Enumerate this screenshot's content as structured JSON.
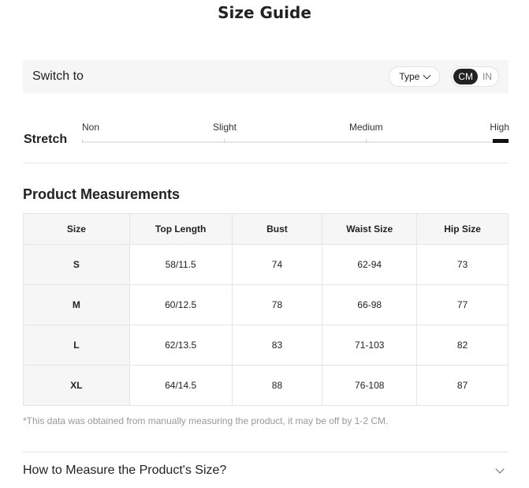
{
  "title": "Size Guide",
  "switch_bar": {
    "label": "Switch to",
    "type_label": "Type",
    "units": [
      {
        "label": "CM",
        "active": true
      },
      {
        "label": "IN",
        "active": false
      }
    ]
  },
  "stretch": {
    "label": "Stretch",
    "levels": [
      "Non",
      "Slight",
      "Medium",
      "High"
    ],
    "selected": "High"
  },
  "measurements": {
    "title": "Product Measurements",
    "columns": [
      "Size",
      "Top Length",
      "Bust",
      "Waist Size",
      "Hip Size"
    ],
    "rows": [
      [
        "S",
        "58/11.5",
        "74",
        "62-94",
        "73"
      ],
      [
        "M",
        "60/12.5",
        "78",
        "66-98",
        "77"
      ],
      [
        "L",
        "62/13.5",
        "83",
        "71-103",
        "82"
      ],
      [
        "XL",
        "64/14.5",
        "88",
        "76-108",
        "87"
      ]
    ],
    "note": "*This data was obtained from manually measuring the product, it may be off by 1-2 CM."
  },
  "how_to": {
    "label": "How to Measure the Product's Size?",
    "icon": "chevron-down-icon"
  }
}
